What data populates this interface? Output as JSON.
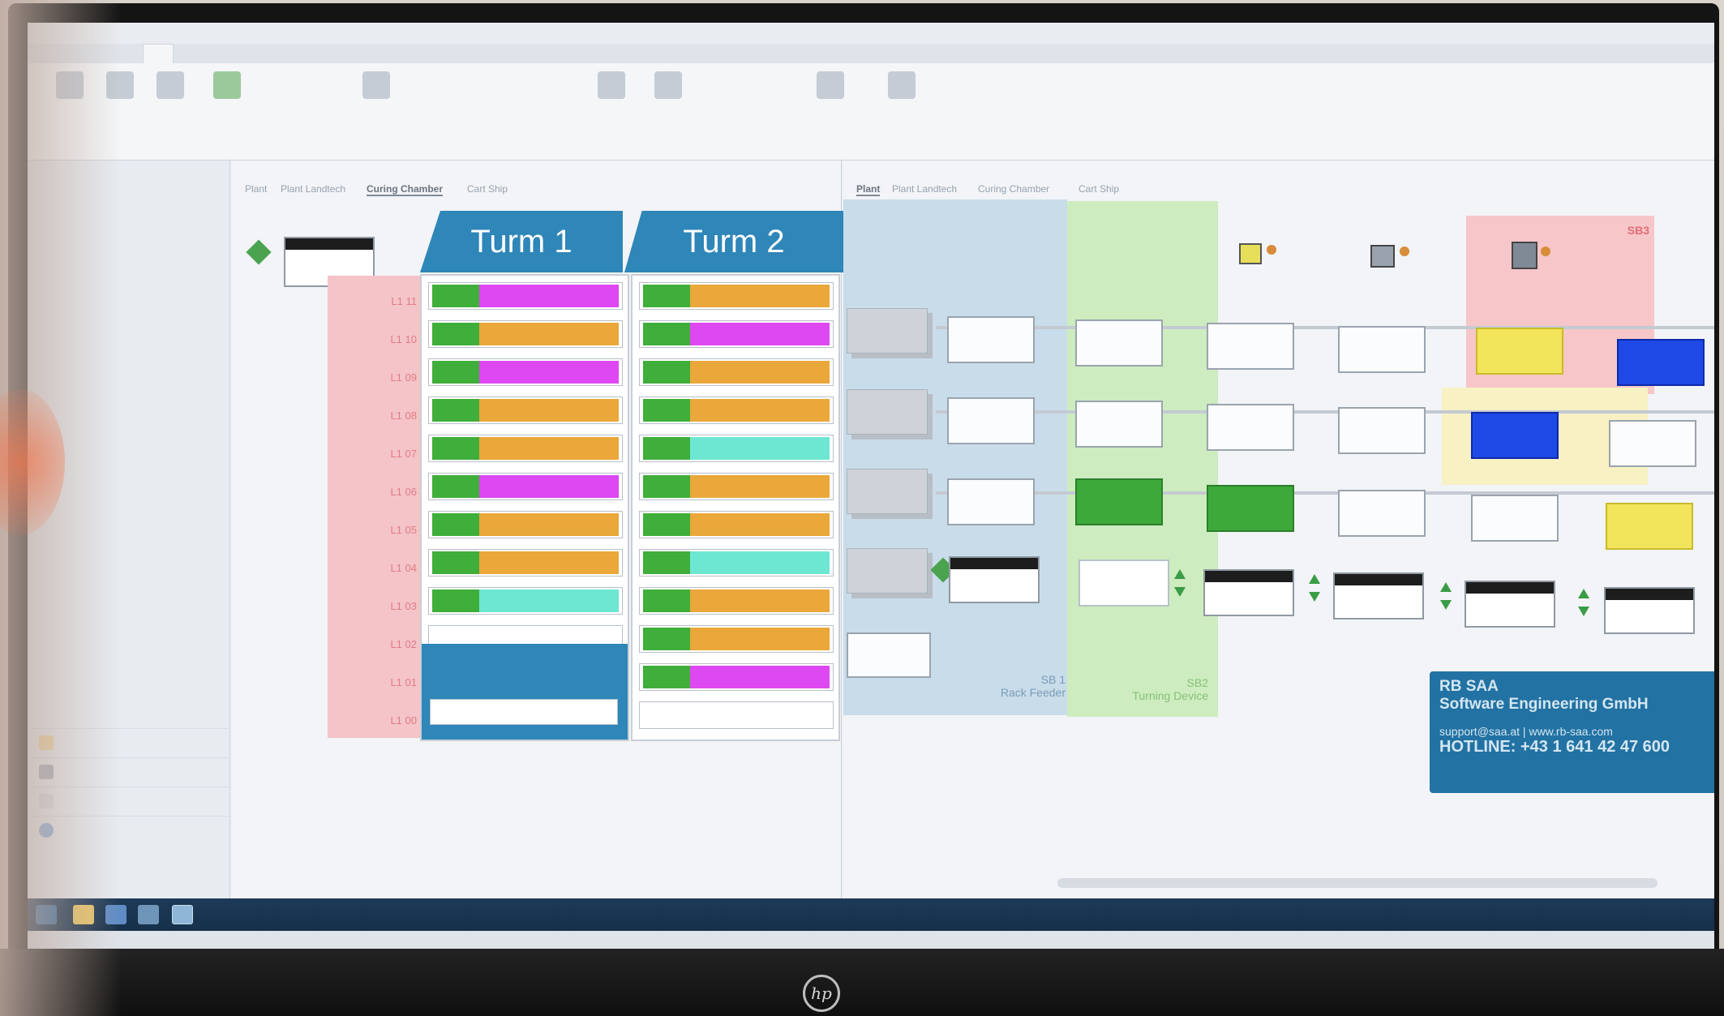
{
  "turm1": {
    "title": "Turm 1"
  },
  "turm2": {
    "title": "Turm 2"
  },
  "levels": [
    "L1 11",
    "L1 10",
    "L1 09",
    "L1 08",
    "L1 07",
    "L1 06",
    "L1 05",
    "L1 04",
    "L1 03",
    "L1 02",
    "L1 01",
    "L1 00"
  ],
  "turm1_slots": [
    {
      "color": "magenta"
    },
    {
      "color": "orange"
    },
    {
      "color": "magenta"
    },
    {
      "color": "orange"
    },
    {
      "color": "orange"
    },
    {
      "color": "magenta"
    },
    {
      "color": "orange"
    },
    {
      "color": "orange"
    },
    {
      "color": "cyan"
    },
    {
      "color": "empty"
    }
  ],
  "turm2_slots": [
    {
      "color": "orange"
    },
    {
      "color": "magenta"
    },
    {
      "color": "orange"
    },
    {
      "color": "orange"
    },
    {
      "color": "cyan"
    },
    {
      "color": "orange"
    },
    {
      "color": "orange"
    },
    {
      "color": "cyan"
    },
    {
      "color": "orange"
    },
    {
      "color": "orange"
    },
    {
      "color": "magenta"
    },
    {
      "color": "empty"
    }
  ],
  "plant": {
    "zones": [
      {
        "label": "SB 1\nRack Feeder",
        "color": "#c9dcea"
      },
      {
        "label": "SB2\nTurning Device",
        "color": "#cdecbf"
      },
      {
        "label": "SB3",
        "color": "#f6c6c8"
      }
    ]
  },
  "info": {
    "company_line1": "RB SAA",
    "company_line2": "Software Engineering GmbH",
    "contact": "support@saa.at | www.rb-saa.com",
    "hotline": "HOTLINE: +43 1 641 42 47 600"
  },
  "subtabs": {
    "center": [
      "Plant",
      "Plant Landtech",
      "Curing Chamber",
      "Cart Ship"
    ],
    "right": [
      "Plant",
      "Plant Landtech",
      "Curing Chamber",
      "Cart Ship"
    ]
  },
  "colors": {
    "turm_head": "#2f86b8",
    "level_bg": "#f4c4c8",
    "orange": "#eaa73a",
    "magenta": "#de48f2",
    "cyan": "#6ee7d2",
    "green": "#3fae3a",
    "info_bg": "#2272a3"
  },
  "brand": {
    "monitor_logo": "hp"
  }
}
